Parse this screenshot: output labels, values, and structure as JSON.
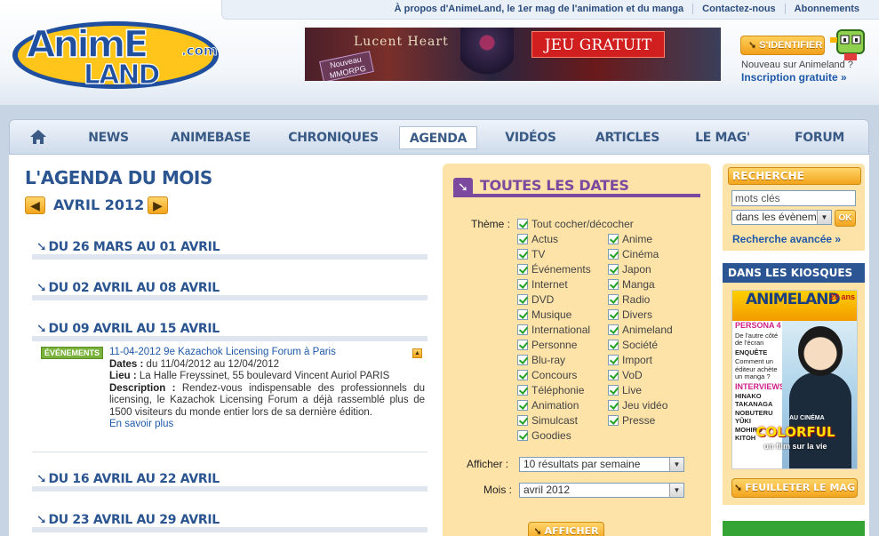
{
  "header": {
    "top_links": [
      "À propos d'AnimeLand, le 1er mag de l'animation et du manga",
      "Contactez-nous",
      "Abonnements"
    ],
    "logo_text": "AnimeLand.com",
    "banner": {
      "title": "Lucent Heart",
      "cta": "JEU GRATUIT",
      "tag": "Nouveau MMORPG"
    },
    "login_label": "S'IDENTIFIER",
    "new_user_text": "Nouveau sur Animeland ?",
    "signup_label": "Inscription gratuite »"
  },
  "nav": {
    "items": [
      "NEWS",
      "ANIMEBASE",
      "CHRONIQUES",
      "AGENDA",
      "VIDÉOS",
      "ARTICLES",
      "LE MAG'",
      "FORUM"
    ],
    "active": "AGENDA"
  },
  "agenda": {
    "title": "L'AGENDA DU MOIS",
    "month": "AVRIL 2012",
    "weeks": [
      "DU 26 MARS AU 01 AVRIL",
      "DU 02 AVRIL AU 08 AVRIL",
      "DU 09 AVRIL AU 15 AVRIL",
      "DU 16 AVRIL AU 22 AVRIL",
      "DU 23 AVRIL AU 29 AVRIL"
    ],
    "event": {
      "category": "ÉVÉNEMENTS",
      "headline": "11-04-2012  9e Kazachok Licensing Forum à Paris",
      "dates_label": "Dates :",
      "dates": " du 11/04/2012 au 12/04/2012",
      "lieu_label": "Lieu :",
      "lieu": " La Halle Freyssinet, 55 boulevard Vincent Auriol PARIS",
      "desc_label": "Description :",
      "desc": " Rendez-vous indispensable des professionnels du licensing, le Kazachok Licensing Forum a déjà rassemblé plus de 1500 visiteurs du monde entier lors de sa dernière édition.",
      "more": "En savoir plus"
    }
  },
  "filter": {
    "title": "TOUTES LES DATES",
    "theme_label": "Thème :",
    "check_all": "Tout cocher/décocher",
    "col1": [
      "Actus",
      "TV",
      "Événements",
      "Internet",
      "DVD",
      "Musique",
      "International",
      "Personne",
      "Blu-ray",
      "Concours",
      "Téléphonie",
      "Animation",
      "Simulcast",
      "Goodies"
    ],
    "col2": [
      "Anime",
      "Cinéma",
      "Japon",
      "Manga",
      "Radio",
      "Divers",
      "Animeland",
      "Société",
      "Import",
      "VoD",
      "Live",
      "Jeu vidéo",
      "Presse"
    ],
    "afficher_label": "Afficher :",
    "afficher_value": "10 résultats par semaine",
    "mois_label": "Mois :",
    "mois_value": "avril 2012",
    "submit": "AFFICHER"
  },
  "sidebar": {
    "search_title": "RECHERCHE",
    "search_placeholder": "mots clés",
    "search_scope": "dans les évènem",
    "ok": "OK",
    "advanced": "Recherche avancée »",
    "kiosque_title": "DANS LES KIOSQUES",
    "mag": {
      "logo": "ANIMELAND",
      "issue": "20 ans",
      "lines": [
        "PERSONA 4",
        "De l'autre côté de l'écran",
        "ENQUÊTE",
        "Comment un éditeur achète un manga ?",
        "INTERVIEWS",
        "HINAKO TAKANAGA",
        "NOBUTERU YÛKI",
        "MOHIRO KITOH"
      ],
      "cinema": "AU CINÉMA",
      "headline": "COLORFUL",
      "subline": "un film sur la vie"
    },
    "feuilleter": "FEUILLETER LE MAG"
  },
  "colors": {
    "accent_blue": "#2b5590",
    "orange": "#f3a41c",
    "purple": "#7b4a9e",
    "panel_bg": "#fde3a8",
    "nav_bg": "#cfdbeb"
  }
}
